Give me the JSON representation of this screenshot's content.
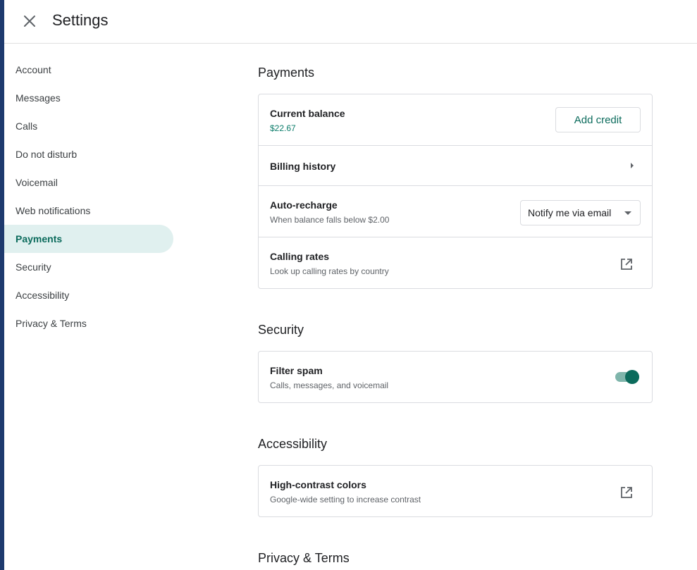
{
  "header": {
    "title": "Settings",
    "close_icon": "close-icon"
  },
  "nav": {
    "items": [
      {
        "label": "Account"
      },
      {
        "label": "Messages"
      },
      {
        "label": "Calls"
      },
      {
        "label": "Do not disturb"
      },
      {
        "label": "Voicemail"
      },
      {
        "label": "Web notifications"
      },
      {
        "label": "Payments",
        "active": true
      },
      {
        "label": "Security"
      },
      {
        "label": "Accessibility"
      },
      {
        "label": "Privacy & Terms"
      }
    ]
  },
  "payments": {
    "title": "Payments",
    "current_balance": {
      "title": "Current balance",
      "value": "$22.67",
      "button": "Add credit"
    },
    "billing_history": {
      "title": "Billing history",
      "icon": "chevron-right-icon"
    },
    "auto_recharge": {
      "title": "Auto-recharge",
      "subtitle": "When balance falls below $2.00",
      "selected": "Notify me via email"
    },
    "calling_rates": {
      "title": "Calling rates",
      "subtitle": "Look up calling rates by country",
      "icon": "open-in-new-icon"
    }
  },
  "security": {
    "title": "Security",
    "filter_spam": {
      "title": "Filter spam",
      "subtitle": "Calls, messages, and voicemail",
      "enabled": true
    }
  },
  "accessibility": {
    "title": "Accessibility",
    "high_contrast": {
      "title": "High-contrast colors",
      "subtitle": "Google-wide setting to increase contrast",
      "icon": "open-in-new-icon"
    }
  },
  "privacy": {
    "title": "Privacy & Terms"
  },
  "colors": {
    "accent": "#0b6b5c",
    "active_nav_bg": "#e0f0ef",
    "left_edge": "#1e3a6e"
  }
}
